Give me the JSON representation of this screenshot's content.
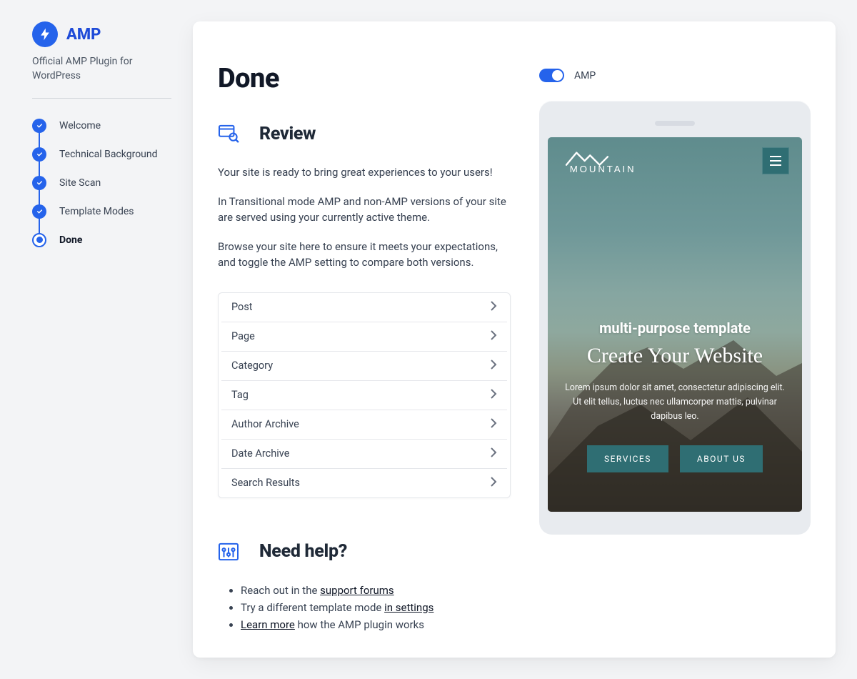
{
  "brand": {
    "title": "AMP",
    "subtitle": "Official AMP Plugin for WordPress"
  },
  "steps": [
    {
      "label": "Welcome",
      "state": "done"
    },
    {
      "label": "Technical Background",
      "state": "done"
    },
    {
      "label": "Site Scan",
      "state": "done"
    },
    {
      "label": "Template Modes",
      "state": "done"
    },
    {
      "label": "Done",
      "state": "current"
    }
  ],
  "page": {
    "title": "Done",
    "review_heading": "Review",
    "review_para_1": "Your site is ready to bring great experiences to your users!",
    "review_para_2": "In Transitional mode AMP and non-AMP versions of your site are served using your currently active theme.",
    "review_para_3": "Browse your site here to ensure it meets your expectations, and toggle the AMP setting to compare both versions.",
    "types": [
      "Post",
      "Page",
      "Category",
      "Tag",
      "Author Archive",
      "Date Archive",
      "Search Results"
    ],
    "help_heading": "Need help?",
    "help_items": [
      {
        "prefix": "Reach out in the ",
        "link": "support forums",
        "suffix": ""
      },
      {
        "prefix": "Try a different template mode ",
        "link": "in settings",
        "suffix": ""
      },
      {
        "prefix": "",
        "link": "Learn more",
        "suffix": " how the AMP plugin works"
      }
    ]
  },
  "toggle": {
    "label": "AMP",
    "on": true
  },
  "preview": {
    "logo_text": "MOUNTAIN",
    "subheading": "multi-purpose template",
    "heading": "Create Your Website",
    "lorem": "Lorem ipsum dolor sit amet, consectetur adipiscing elit. Ut elit tellus, luctus nec ullamcorper mattis, pulvinar dapibus leo.",
    "btn_services": "SERVICES",
    "btn_about": "ABOUT US"
  }
}
